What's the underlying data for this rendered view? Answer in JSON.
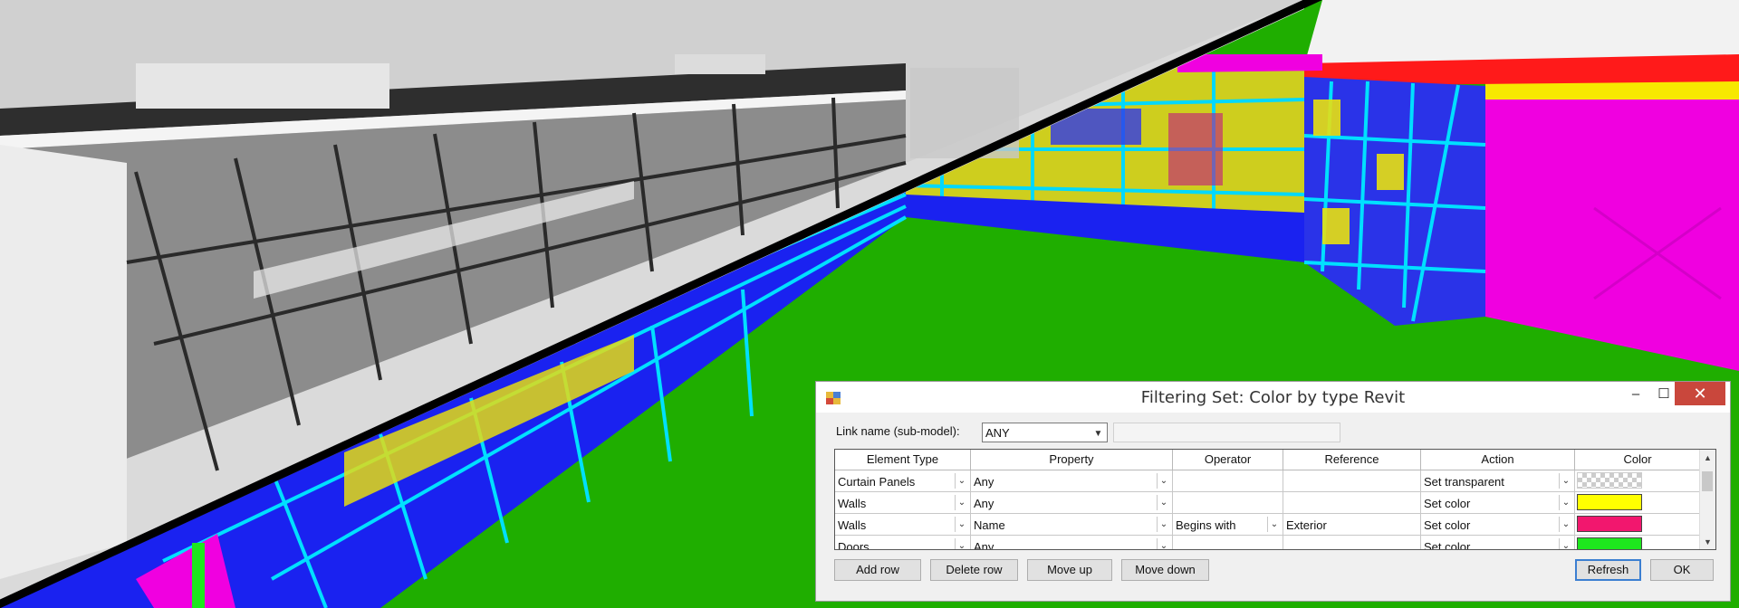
{
  "dialog": {
    "title": "Filtering Set: Color by type Revit",
    "controls": {
      "minimize": "–",
      "maximize": "☐",
      "close": "✕"
    },
    "link_label": "Link name (sub-model):",
    "link_value": "ANY",
    "columns": [
      "Element Type",
      "Property",
      "Operator",
      "Reference",
      "Action",
      "Color"
    ],
    "rows": [
      {
        "element_type": "Curtain Panels",
        "property": "Any",
        "operator": "",
        "reference": "",
        "action": "Set transparent",
        "color": "transparent"
      },
      {
        "element_type": "Walls",
        "property": "Any",
        "operator": "",
        "reference": "",
        "action": "Set color",
        "color": "#ffff00"
      },
      {
        "element_type": "Walls",
        "property": "Name",
        "operator": "Begins with",
        "reference": "Exterior",
        "action": "Set color",
        "color": "#f2176e"
      },
      {
        "element_type": "Doors",
        "property": "Any",
        "operator": "",
        "reference": "",
        "action": "Set color",
        "color": "#1ee81e"
      }
    ],
    "buttons": {
      "add_row": "Add row",
      "delete_row": "Delete row",
      "move_up": "Move up",
      "move_down": "Move down",
      "refresh": "Refresh",
      "ok": "OK"
    }
  },
  "scene_colors": {
    "ground": "#1fae00",
    "floor": "#1a22f0",
    "wall_yellow": "#f2e60a",
    "frame_cyan": "#00e0ff",
    "wall_magenta": "#f000e0",
    "roof_red": "#ff1010"
  }
}
